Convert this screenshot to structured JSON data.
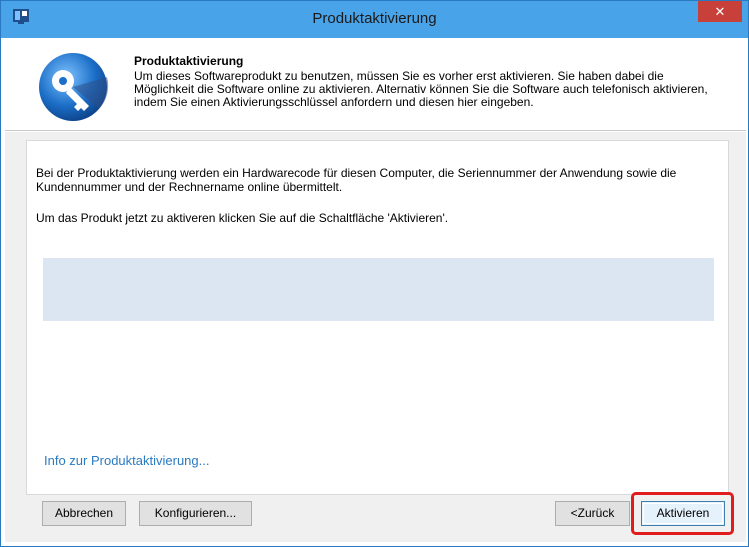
{
  "window": {
    "title": "Produktaktivierung",
    "close_glyph": "✕"
  },
  "header": {
    "title": "Produktaktivierung",
    "description": "Um dieses Softwareprodukt zu benutzen, müssen Sie es vorher erst aktivieren. Sie haben dabei die Möglichkeit die Software online zu aktivieren. Alternativ können Sie die Software auch telefonisch aktivieren, indem Sie einen Aktivierungsschlüssel anfordern und diesen hier eingeben.",
    "icon": "key-icon"
  },
  "content": {
    "paragraph1": "Bei der Produktaktivierung werden ein Hardwarecode für diesen Computer, die Seriennummer der Anwendung sowie die Kundennummer und der Rechnername online übermittelt.",
    "paragraph2": "Um das Produkt jetzt zu aktiveren klicken Sie auf die Schaltfläche 'Aktivieren'.",
    "info_link": "Info zur Produktaktivierung..."
  },
  "buttons": {
    "cancel": "Abbrechen",
    "configure": "Konfigurieren...",
    "back": "<Zurück",
    "activate": "Aktivieren"
  },
  "colors": {
    "titlebar": "#49a3e8",
    "close": "#c7413a",
    "link": "#2a7ac0",
    "highlight": "#e01c1c",
    "status_box": "#dce6f2"
  }
}
